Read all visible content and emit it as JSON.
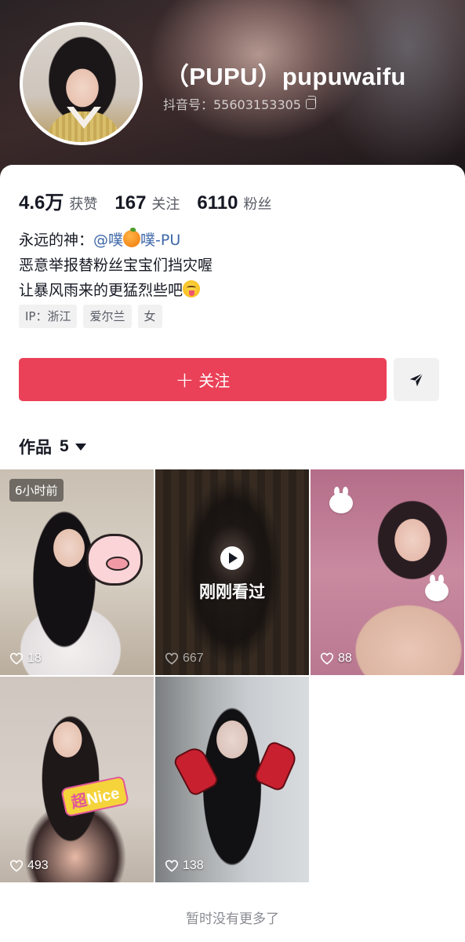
{
  "profile": {
    "nickname": "（PUPU）pupuwaifu",
    "douyin_id": "抖音号：55603153305"
  },
  "stats": {
    "likes": {
      "value": "4.6万",
      "label": "获赞"
    },
    "following": {
      "value": "167",
      "label": "关注"
    },
    "followers": {
      "value": "6110",
      "label": "粉丝"
    }
  },
  "bio": {
    "line1_prefix": "永远的神：",
    "line1_mention_a": "@噗",
    "line1_mention_b": "噗-PU",
    "line2": "恶意举报替粉丝宝宝们挡灾喔",
    "line3": "让暴风雨来的更猛烈些吧"
  },
  "tags": [
    "IP：浙江",
    "爱尔兰",
    "女"
  ],
  "actions": {
    "follow_plus": "+",
    "follow_label": "关注"
  },
  "works": {
    "title": "作品",
    "count": "5",
    "items": [
      {
        "likes": "18",
        "badge": "6小时前"
      },
      {
        "likes": "667",
        "overlay": "刚刚看过"
      },
      {
        "likes": "88"
      },
      {
        "likes": "493",
        "sticker_a": "超",
        "sticker_b": "Nice"
      },
      {
        "likes": "138"
      }
    ]
  },
  "footer": {
    "no_more": "暂时没有更多了"
  },
  "colors": {
    "accent": "#ea4158",
    "mention": "#3d67a8"
  }
}
